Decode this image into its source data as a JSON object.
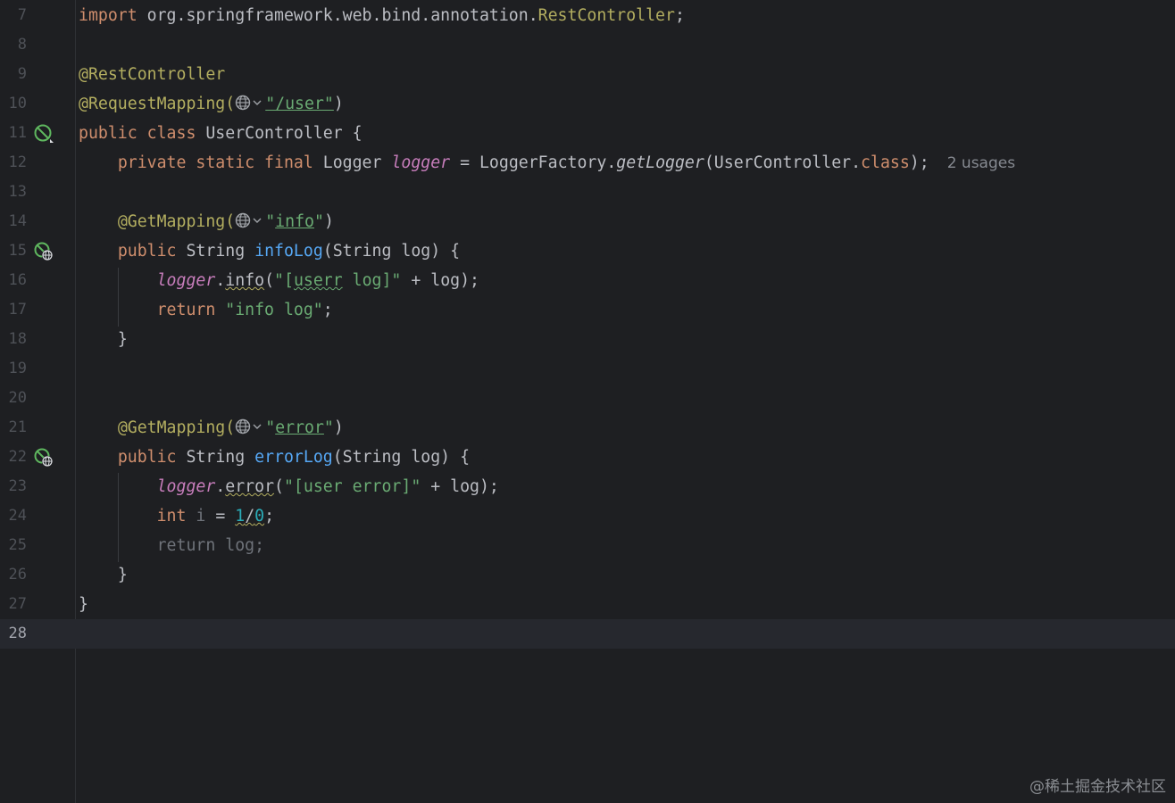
{
  "editor": {
    "lines": [
      {
        "n": "7"
      },
      {
        "n": "8"
      },
      {
        "n": "9"
      },
      {
        "n": "10"
      },
      {
        "n": "11"
      },
      {
        "n": "12"
      },
      {
        "n": "13"
      },
      {
        "n": "14"
      },
      {
        "n": "15"
      },
      {
        "n": "16"
      },
      {
        "n": "17"
      },
      {
        "n": "18"
      },
      {
        "n": "19"
      },
      {
        "n": "20"
      },
      {
        "n": "21"
      },
      {
        "n": "22"
      },
      {
        "n": "23"
      },
      {
        "n": "24"
      },
      {
        "n": "25"
      },
      {
        "n": "26"
      },
      {
        "n": "27"
      },
      {
        "n": "28"
      }
    ],
    "code": {
      "l7_kw": "import",
      "l7_pkg": " org.springframework.web.bind.annotation.",
      "l7_cls": "RestController",
      "l7_end": ";",
      "l9_ann": "@RestController",
      "l10_ann": "@RequestMapping(",
      "l10_str": "\"/user\"",
      "l10_end": ")",
      "l11_kw": "public class",
      "l11_rest": " UserController {",
      "l12_kw": "private static final",
      "l12_type": " Logger ",
      "l12_fld": "logger",
      "l12_eq": " = LoggerFactory.",
      "l12_fn": "getLogger",
      "l12_arg": "(UserController.",
      "l12_cls": "class",
      "l12_end": ");",
      "l12_hint": "2 usages",
      "l14_ann": "@GetMapping(",
      "l14_str_q1": "\"",
      "l14_str_v": "info",
      "l14_str_q2": "\"",
      "l14_end": ")",
      "l15_kw": "public",
      "l15_type": " String ",
      "l15_fn": "infoLog",
      "l15_rest": "(String log) {",
      "l16_fld": "logger",
      "l16_dot": ".",
      "l16_m": "info",
      "l16_p": "(",
      "l16_s1": "\"[",
      "l16_s2": "userr",
      "l16_s3": " log]\"",
      "l16_rest": " + log);",
      "l17_kw": "return",
      "l17_str": " \"info log\"",
      "l17_end": ";",
      "l18": "}",
      "l21_ann": "@GetMapping(",
      "l21_str_q1": "\"",
      "l21_str_v": "error",
      "l21_str_q2": "\"",
      "l21_end": ")",
      "l22_kw": "public",
      "l22_type": " String ",
      "l22_fn": "errorLog",
      "l22_rest": "(String log) {",
      "l23_fld": "logger",
      "l23_dot": ".",
      "l23_m": "error",
      "l23_p": "(",
      "l23_str": "\"[user error]\"",
      "l23_rest": " + log);",
      "l24_kw": "int",
      "l24_var": " i",
      "l24_eq": " = ",
      "l24_n1": "1",
      "l24_op": "/",
      "l24_n2": "0",
      "l24_end": ";",
      "l25": "return log;",
      "l26": "}",
      "l27": "}"
    },
    "gutter_icons": {
      "l11": "spring-bean-icon",
      "l15": "request-mapping-globe-icon",
      "l22": "request-mapping-globe-icon"
    },
    "current_line": "28"
  },
  "watermark": "@稀土掘金技术社区"
}
